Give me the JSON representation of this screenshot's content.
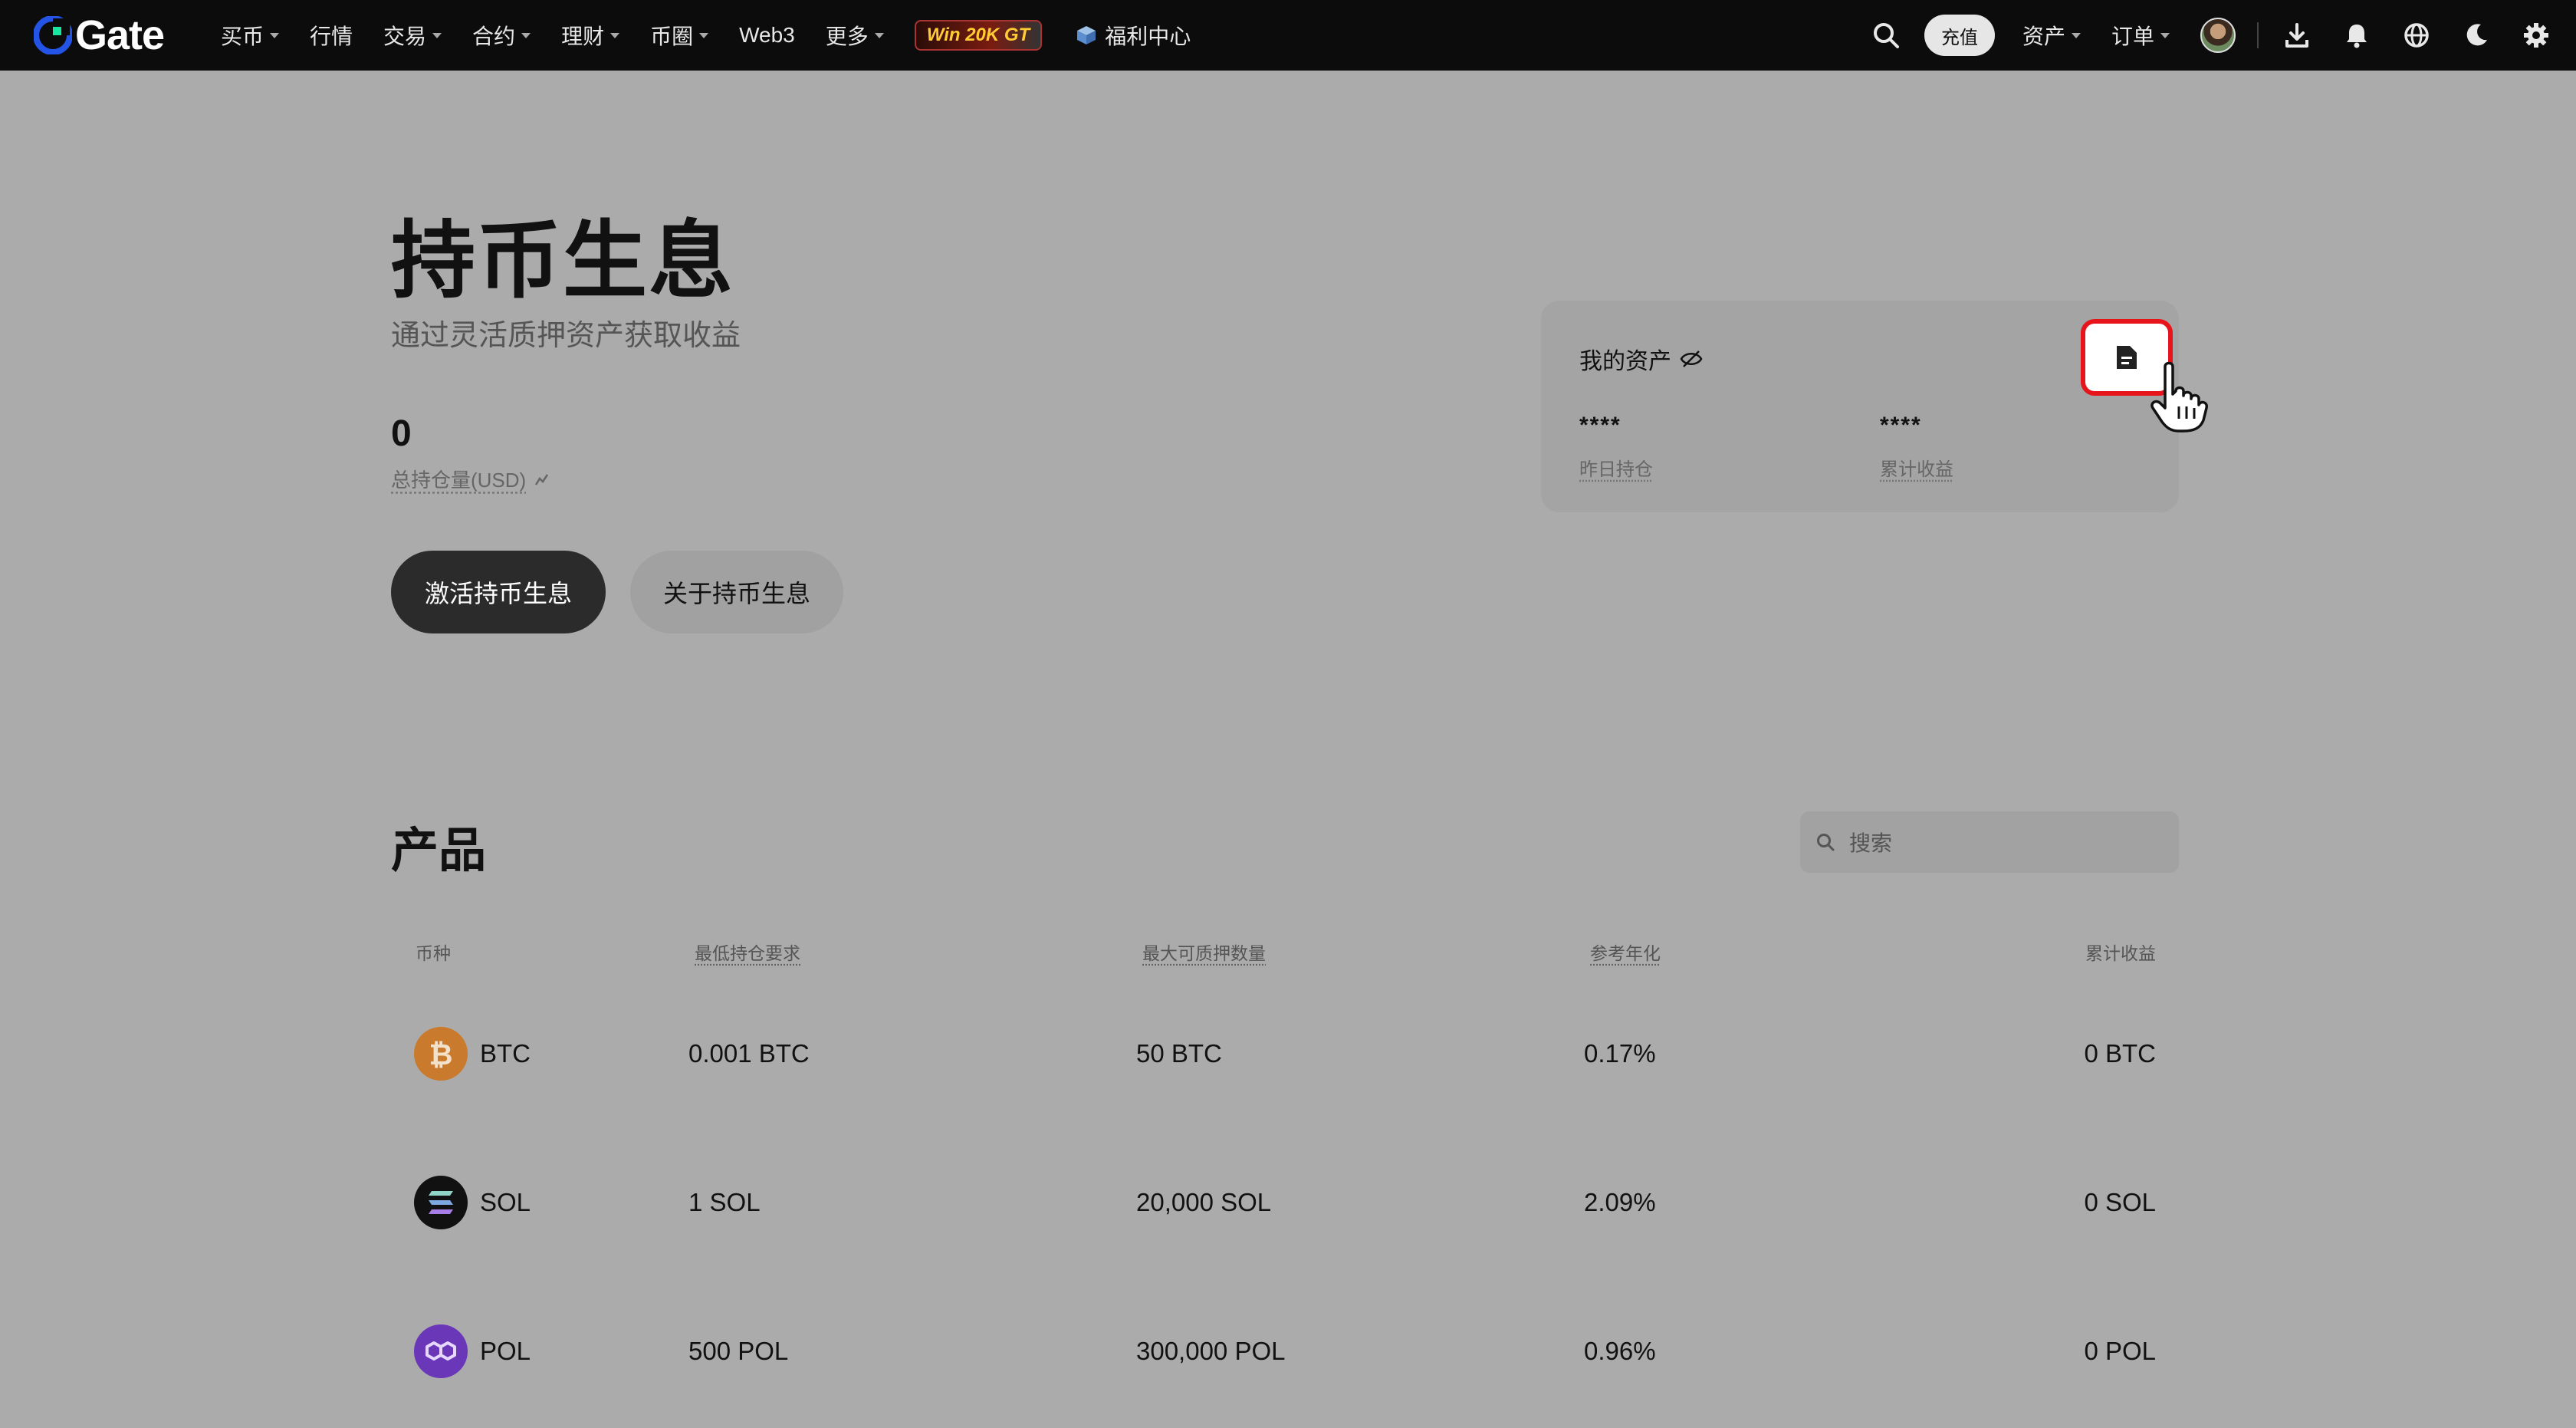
{
  "nav": {
    "logo_text": "Gate",
    "items": [
      {
        "label": "买币",
        "caret": true
      },
      {
        "label": "行情",
        "caret": false
      },
      {
        "label": "交易",
        "caret": true
      },
      {
        "label": "合约",
        "caret": true
      },
      {
        "label": "理财",
        "caret": true
      },
      {
        "label": "币圈",
        "caret": true
      },
      {
        "label": "Web3",
        "caret": false
      },
      {
        "label": "更多",
        "caret": true
      }
    ],
    "promo": "Win 20K GT",
    "welfare": "福利中心",
    "deposit": "充值",
    "assets": "资产",
    "orders": "订单"
  },
  "hero": {
    "title": "持币生息",
    "subtitle": "通过灵活质押资产获取收益",
    "total_value": "0",
    "total_label": "总持仓量(USD)",
    "activate_button": "激活持币生息",
    "about_button": "关于持币生息"
  },
  "asset_card": {
    "title": "我的资产",
    "yesterday_value": "****",
    "yesterday_label": "昨日持仓",
    "cumulative_value": "****",
    "cumulative_label": "累计收益"
  },
  "products": {
    "title": "产品",
    "search_placeholder": "搜索",
    "columns": [
      "币种",
      "最低持仓要求",
      "最大可质押数量",
      "参考年化",
      "累计收益"
    ],
    "rows": [
      {
        "coin": "BTC",
        "min": "0.001 BTC",
        "max": "50 BTC",
        "apr": "0.17%",
        "earned": "0 BTC",
        "color": "#f7931a"
      },
      {
        "coin": "SOL",
        "min": "1 SOL",
        "max": "20,000 SOL",
        "apr": "2.09%",
        "earned": "0 SOL",
        "color": "#000000"
      },
      {
        "coin": "POL",
        "min": "500 POL",
        "max": "300,000 POL",
        "apr": "0.96%",
        "earned": "0 POL",
        "color": "#7b3fe4"
      }
    ]
  },
  "colors": {
    "highlight_border": "#e8141c",
    "overlay_bg": "#ababab"
  }
}
